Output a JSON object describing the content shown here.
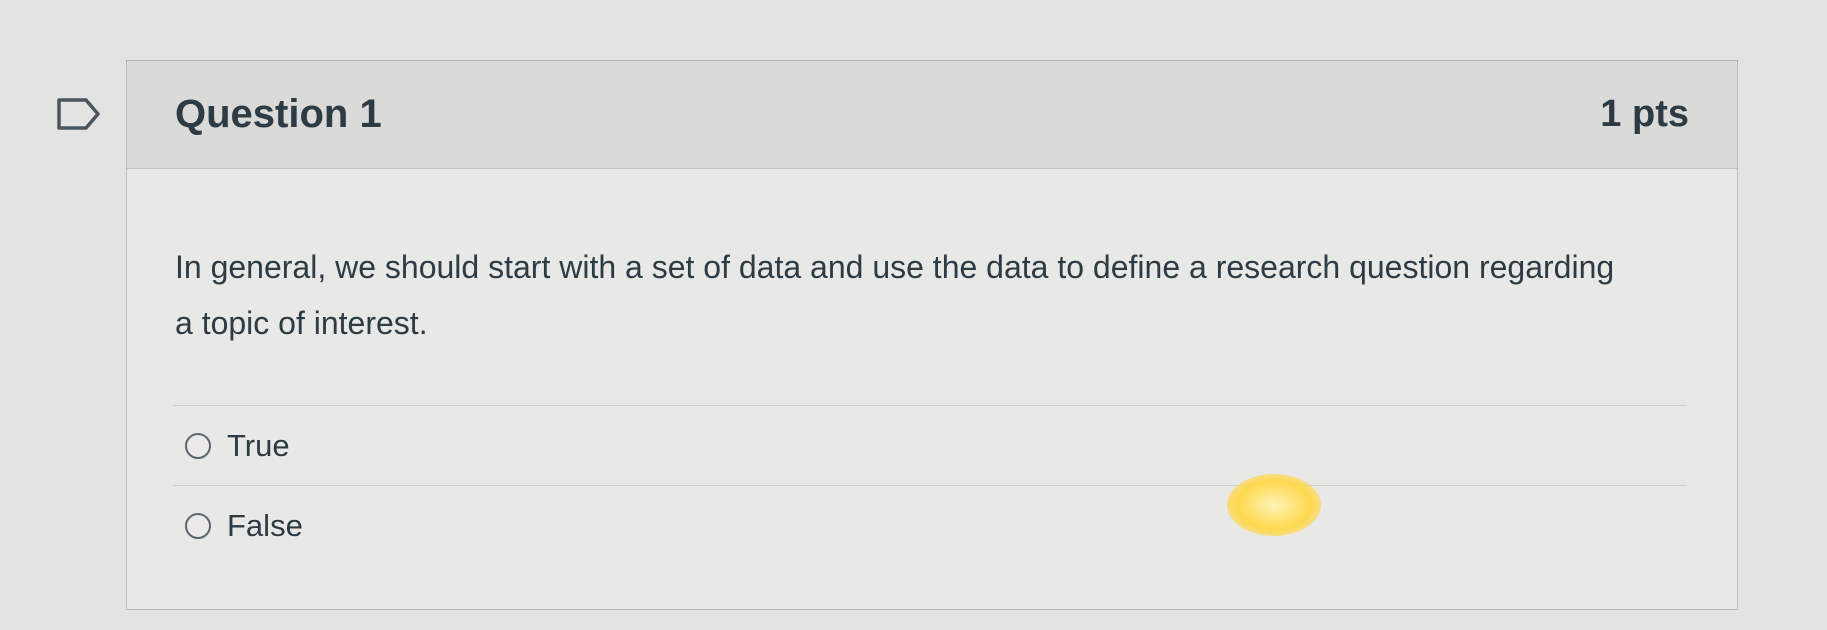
{
  "question": {
    "title": "Question 1",
    "points": "1 pts",
    "text": "In general, we should start with a set of data and use the data to define a research question regarding a topic of interest."
  },
  "answers": [
    {
      "label": "True"
    },
    {
      "label": "False"
    }
  ],
  "colors": {
    "text": "#2d3b45",
    "header_bg": "#dadad8",
    "border": "#b9bab8"
  }
}
